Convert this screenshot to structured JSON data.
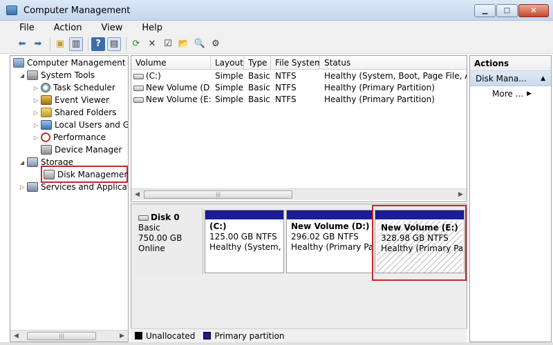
{
  "window": {
    "title": "Computer Management"
  },
  "menu": [
    "File",
    "Action",
    "View",
    "Help"
  ],
  "toolbar": {
    "icons": [
      "back-arrow-icon",
      "forward-arrow-icon",
      "up-folder-icon",
      "show-hide-tree-icon",
      "help-icon",
      "console-view-icon",
      "refresh-icon",
      "delete-icon",
      "properties-icon",
      "open-icon",
      "search-icon",
      "settings-icon"
    ]
  },
  "tree": {
    "root": "Computer Management (L",
    "system_tools": "System Tools",
    "task_scheduler": "Task Scheduler",
    "event_viewer": "Event Viewer",
    "shared_folders": "Shared Folders",
    "local_users": "Local Users and Gro",
    "performance": "Performance",
    "device_manager": "Device Manager",
    "storage": "Storage",
    "disk_management": "Disk Management",
    "services": "Services and Applicatio"
  },
  "volumes": {
    "columns": [
      "Volume",
      "Layout",
      "Type",
      "File System",
      "Status"
    ],
    "rows": [
      {
        "volume": "(C:)",
        "layout": "Simple",
        "type": "Basic",
        "fs": "NTFS",
        "status": "Healthy (System, Boot, Page File, Active"
      },
      {
        "volume": "New Volume (D:)",
        "layout": "Simple",
        "type": "Basic",
        "fs": "NTFS",
        "status": "Healthy (Primary Partition)"
      },
      {
        "volume": "New Volume (E:)",
        "layout": "Simple",
        "type": "Basic",
        "fs": "NTFS",
        "status": "Healthy (Primary Partition)"
      }
    ]
  },
  "disk": {
    "name": "Disk 0",
    "type": "Basic",
    "size": "750.00 GB",
    "state": "Online",
    "partitions": [
      {
        "name": "(C:)",
        "size": "125.00 GB NTFS",
        "status": "Healthy (System, Bo"
      },
      {
        "name": "New Volume  (D:)",
        "size": "296.02 GB NTFS",
        "status": "Healthy (Primary Part"
      },
      {
        "name": "New Volume  (E:)",
        "size": "328.98 GB NTFS",
        "status": "Healthy (Primary Parti"
      }
    ]
  },
  "legend": {
    "unallocated": "Unallocated",
    "primary": "Primary partition",
    "unallocated_color": "#000000",
    "primary_color": "#1c1c96"
  },
  "actions": {
    "header": "Actions",
    "section": "Disk Mana...",
    "more": "More ..."
  },
  "colors": {
    "highlight": "#c0282d",
    "partition_bar": "#1c1c96"
  }
}
